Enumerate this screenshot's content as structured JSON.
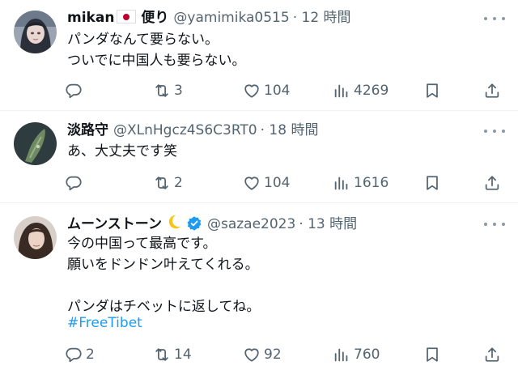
{
  "tweets": [
    {
      "name": "mikan",
      "handle": "@yamimika0515",
      "time": "· 12 時間",
      "text": "パンダなんて要らない。\nついでに中国人も要らない。",
      "replies": "",
      "retweets": "3",
      "likes": "104",
      "views": "4269",
      "name_suffix": "便り"
    },
    {
      "name": "淡路守",
      "handle": "@XLnHgcz4S6C3RT0",
      "time": "· 18 時間",
      "text": "あ、大丈夫です笑",
      "replies": "",
      "retweets": "2",
      "likes": "104",
      "views": "1616"
    },
    {
      "name": "ムーンストーン",
      "handle": "@sazae2023",
      "time": "· 13 時間",
      "text": "今の中国って最高です。\n願いをドンドン叶えてくれる。\n\nパンダはチベットに返してね。",
      "hashtag": "#FreeTibet",
      "replies": "2",
      "retweets": "14",
      "likes": "92",
      "views": "760"
    }
  ],
  "colors": {
    "text": "#0f1419",
    "secondary": "#536471",
    "link": "#1d9bf0",
    "divider": "#eff3f4",
    "verified": "#1d9bf0"
  },
  "icons": [
    "reply-icon",
    "retweet-icon",
    "like-icon",
    "views-icon",
    "bookmark-icon",
    "share-icon",
    "more-icon",
    "verified-badge-icon",
    "crescent-moon-icon",
    "japan-flag-icon"
  ]
}
